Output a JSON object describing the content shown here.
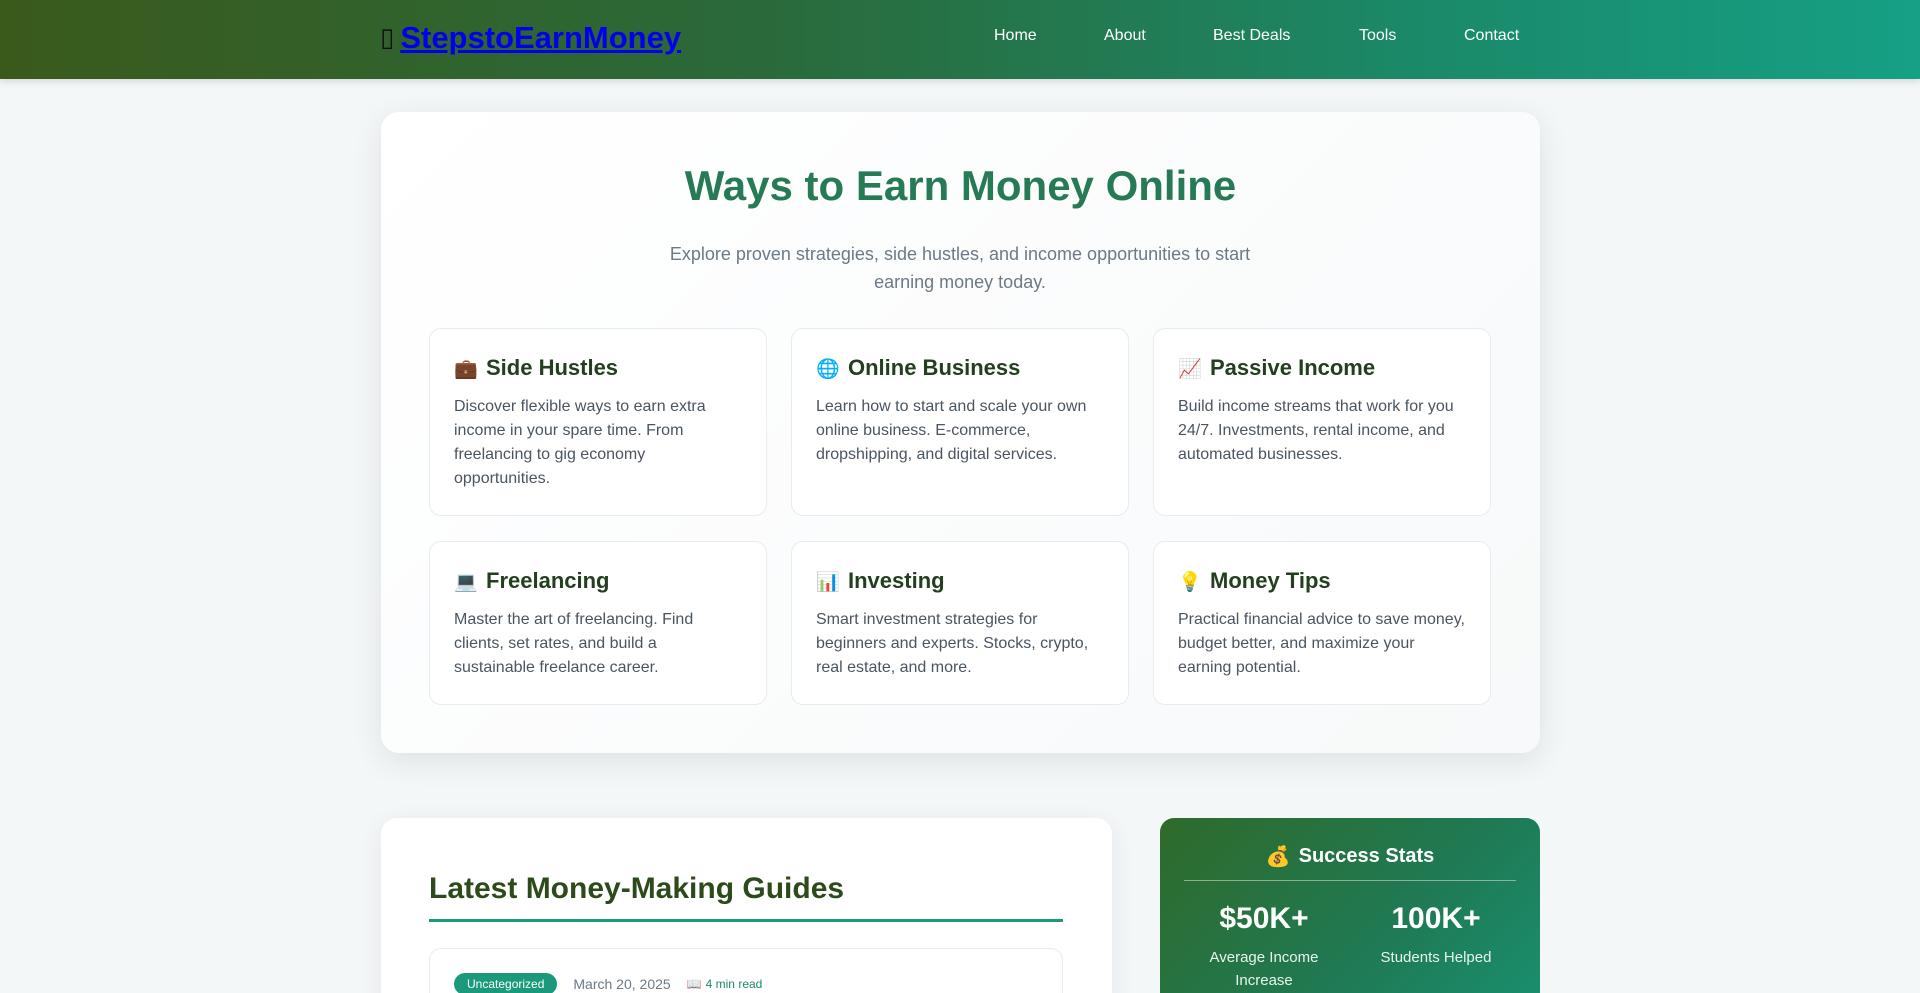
{
  "header": {
    "brand_icon": "▯",
    "brand_label": "StepstoEarnMoney",
    "nav": [
      "Home",
      "About",
      "Best Deals",
      "Tools",
      "Contact"
    ]
  },
  "hero": {
    "title": "Ways to Earn Money Online",
    "subtitle": "Explore proven strategies, side hustles, and income opportunities to start earning money today.",
    "cards": [
      {
        "icon": "💼",
        "icon_name": "briefcase-icon",
        "title": "Side Hustles",
        "desc": "Discover flexible ways to earn extra income in your spare time. From freelancing to gig economy opportunities."
      },
      {
        "icon": "🌐",
        "icon_name": "globe-icon",
        "title": "Online Business",
        "desc": "Learn how to start and scale your own online business. E-commerce, dropshipping, and digital services."
      },
      {
        "icon": "📈",
        "icon_name": "chart-up-icon",
        "title": "Passive Income",
        "desc": "Build income streams that work for you 24/7. Investments, rental income, and automated businesses."
      },
      {
        "icon": "💻",
        "icon_name": "laptop-icon",
        "title": "Freelancing",
        "desc": "Master the art of freelancing. Find clients, set rates, and build a sustainable freelance career."
      },
      {
        "icon": "📊",
        "icon_name": "bar-chart-icon",
        "title": "Investing",
        "desc": "Smart investment strategies for beginners and experts. Stocks, crypto, real estate, and more."
      },
      {
        "icon": "💡",
        "icon_name": "lightbulb-icon",
        "title": "Money Tips",
        "desc": "Practical financial advice to save money, budget better, and maximize your earning potential."
      }
    ]
  },
  "guides": {
    "title": "Latest Money-Making Guides",
    "post": {
      "category": "Uncategorized",
      "date": "March 20, 2025",
      "read_icon": "📖",
      "read_time": "4 min read"
    }
  },
  "stats": {
    "icon": "💰",
    "title": "Success Stats",
    "items": [
      {
        "value": "$50K+",
        "label": "Average Income Increase"
      },
      {
        "value": "100K+",
        "label": "Students Helped"
      }
    ]
  },
  "colors": {
    "accent": "#1a9a7a",
    "heading_green": "#267a55",
    "dark_green": "#2d4a1a",
    "link_blue": "#0000ee"
  }
}
